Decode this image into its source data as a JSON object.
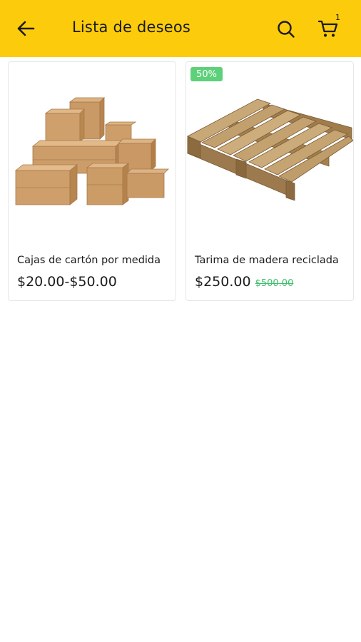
{
  "header": {
    "title": "Lista de deseos",
    "cart_count": "1",
    "background_color": "#fccc0c"
  },
  "icons": {
    "back": "arrow-left-icon",
    "search": "search-icon",
    "cart": "shopping-cart-icon"
  },
  "products": [
    {
      "name": "Cajas de cartón por medida",
      "price": "$20.00-$50.00",
      "old_price": "",
      "discount_badge": ""
    },
    {
      "name": "Tarima de madera reciclada",
      "price": "$250.00",
      "old_price": "$500.00",
      "discount_badge": "50%"
    }
  ],
  "colors": {
    "badge": "#5dd07a",
    "old_price": "#3cbf6a"
  }
}
